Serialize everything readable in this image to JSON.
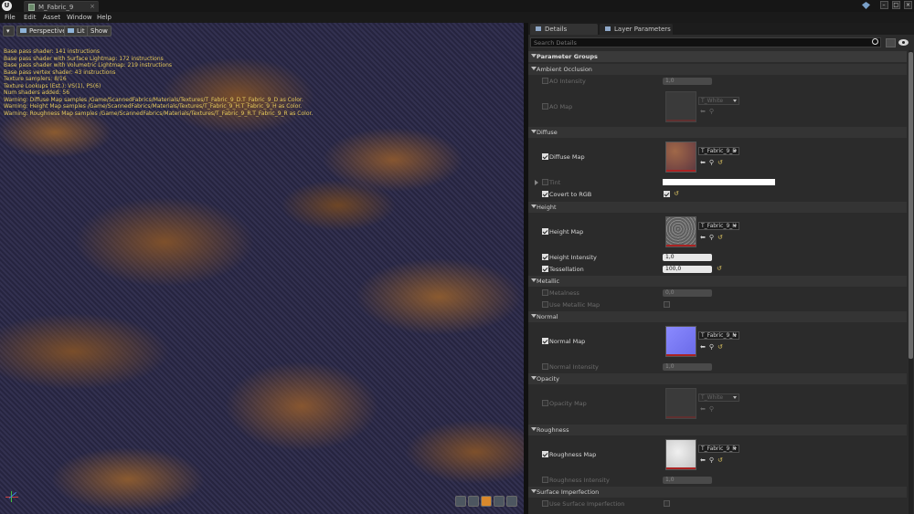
{
  "window": {
    "tab_title": "M_Fabric_9",
    "menu": [
      "File",
      "Edit",
      "Asset",
      "Window",
      "Help"
    ]
  },
  "viewport": {
    "buttons": {
      "perspective": "Perspective",
      "lit": "Lit",
      "show": "Show"
    },
    "stats": [
      "Base pass shader: 141 instructions",
      "Base pass shader with Surface Lightmap: 172 instructions",
      "Base pass shader with Volumetric Lightmap: 219 instructions",
      "Base pass vertex shader: 43 instructions",
      "Texture samplers: 8/16",
      "Texture Lookups (Est.): VS(1), PS(6)",
      "Num shaders added: 56",
      "Warning: Diffuse Map samples /Game/ScannedFabrics/Materials/Textures/T_Fabric_9_D.T_Fabric_9_D as Color.",
      "Warning: Height Map samples /Game/ScannedFabrics/Materials/Textures/T_Fabric_9_H.T_Fabric_9_H as Color.",
      "Warning: Roughness Map samples /Game/ScannedFabrics/Materials/Textures/T_Fabric_9_R.T_Fabric_9_R as Color."
    ]
  },
  "details": {
    "tabs": {
      "details": "Details",
      "layer_parameters": "Layer Parameters"
    },
    "search_placeholder": "Search Details",
    "parameter_groups_label": "Parameter Groups",
    "groups": {
      "ambient_occlusion": "Ambient Occlusion",
      "diffuse": "Diffuse",
      "height": "Height",
      "metallic": "Metallic",
      "normal": "Normal",
      "opacity": "Opacity",
      "roughness": "Roughness",
      "surface_imperfection": "Surface Imperfection"
    },
    "params": {
      "ao_intensity": {
        "label": "AO Intensity",
        "value": "1,0"
      },
      "ao_map": {
        "label": "AO Map",
        "texture": "T_White"
      },
      "diffuse_map": {
        "label": "Diffuse Map",
        "texture": "T_Fabric_9_D"
      },
      "tint": {
        "label": "Tint",
        "color": "#ffffff"
      },
      "covert_to_rgb": {
        "label": "Covert to RGB"
      },
      "height_map": {
        "label": "Height Map",
        "texture": "T_Fabric_9_H"
      },
      "height_intensity": {
        "label": "Height Intensity",
        "value": "1,0"
      },
      "tessellation": {
        "label": "Tessellation",
        "value": "100,0"
      },
      "metalness": {
        "label": "Metalness",
        "value": "0,0"
      },
      "use_metallic_map": {
        "label": "Use Metallic Map"
      },
      "normal_map": {
        "label": "Normal Map",
        "texture": "T_Fabric_9_N"
      },
      "normal_intensity": {
        "label": "Normal Intensity",
        "value": "1,0"
      },
      "opacity_map": {
        "label": "Opacity Map",
        "texture": "T_White"
      },
      "roughness_map": {
        "label": "Roughness Map",
        "texture": "T_Fabric_9_R"
      },
      "roughness_intensity": {
        "label": "Roughness Intensity",
        "value": "1,0"
      },
      "use_surface_imperfection": {
        "label": "Use Surface Imperfection"
      }
    }
  },
  "colors": {
    "accent_orange": "#d9882c",
    "panel_bg": "#2b2b2b",
    "stats_text": "#e6c95a"
  }
}
